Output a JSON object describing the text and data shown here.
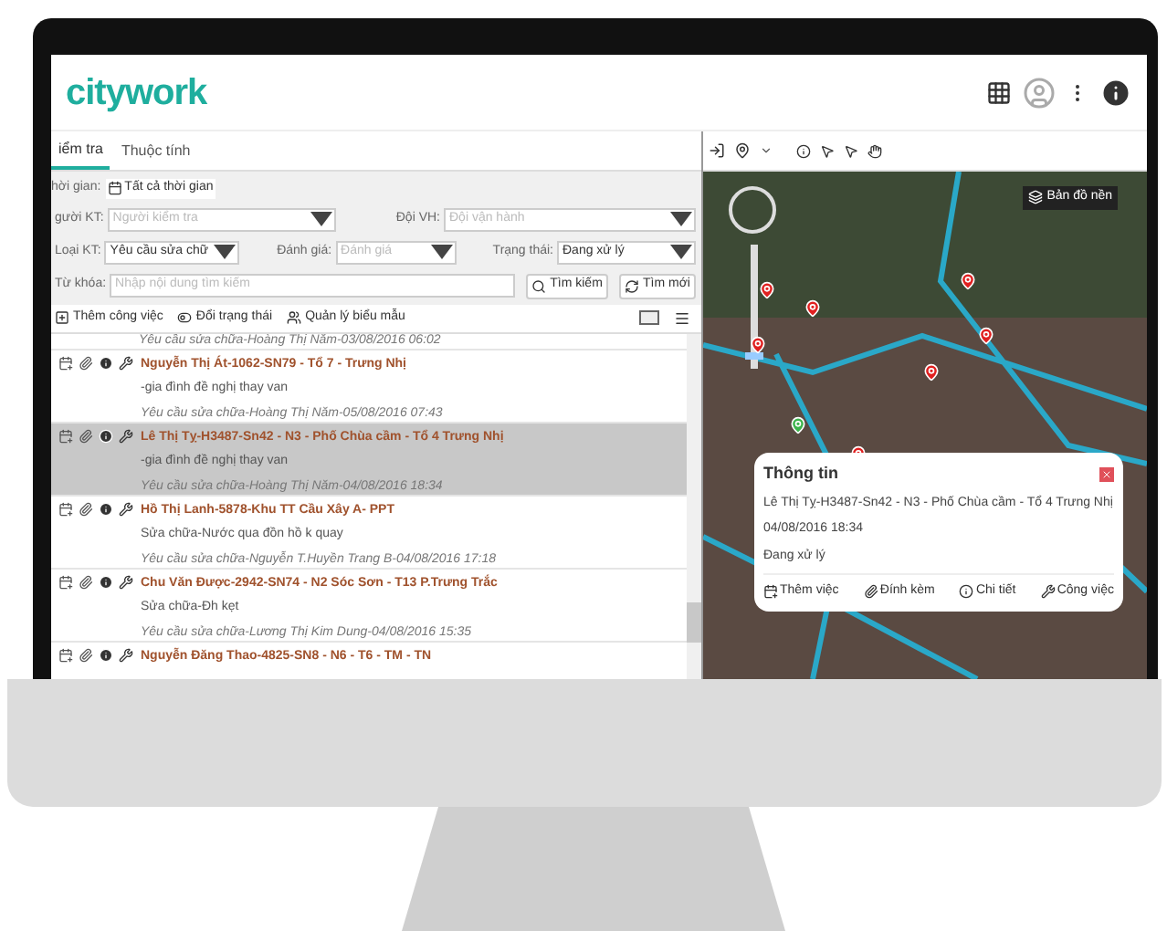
{
  "header": {
    "logo": "citywork"
  },
  "tabs": [
    {
      "label": "iểm tra",
      "selected": true
    },
    {
      "label": "Thuộc tính",
      "selected": false
    }
  ],
  "filters": {
    "time_label": "hời gian:",
    "time_value": "Tất cả thời gian",
    "rows": [
      {
        "fields": [
          {
            "label": "gười KT:",
            "placeholder": "Người kiểm tra",
            "kind": "select"
          },
          {
            "label": "Đội VH:",
            "placeholder": "Đội vận hành",
            "kind": "select"
          }
        ]
      },
      {
        "fields": [
          {
            "label": "Loại KT:",
            "value": "Yêu cầu sửa chữ",
            "kind": "select"
          },
          {
            "label": "Đánh giá:",
            "placeholder": "Đánh giá",
            "kind": "select"
          },
          {
            "label": "Trạng thái:",
            "value": "Đang xử lý",
            "kind": "select"
          }
        ]
      },
      {
        "fields": [
          {
            "label": "Từ khóa:",
            "placeholder": "Nhập nội dung tìm kiếm",
            "kind": "input"
          }
        ]
      }
    ],
    "buttons": [
      "Tìm kiếm",
      "Tìm mới"
    ]
  },
  "toolbar": [
    "Thêm công việc",
    "Đổi trạng thái",
    "Quản lý biểu mẫu"
  ],
  "list": {
    "partial_line": "Yêu cầu sửa chữa-Hoàng Thị Năm-03/08/2016 06:02",
    "items": [
      {
        "title": "Nguyễn Thị Át-1062-SN79 - Tổ 7 - Trưng Nhị",
        "description": "-gia đình đề nghị thay van",
        "meta": "Yêu cầu sửa chữa-Hoàng Thị Năm-05/08/2016 07:43",
        "selected": false
      },
      {
        "title": "Lê Thị Tỵ-H3487-Sn42 - N3 - Phố Chùa cầm - Tổ 4 Trưng Nhị",
        "description": "-gia đình đề nghị thay van",
        "meta": "Yêu cầu sửa chữa-Hoàng Thị Năm-04/08/2016 18:34",
        "selected": true
      },
      {
        "title": "Hồ Thị Lanh-5878-Khu TT Cầu Xây A- PPT",
        "description": "Sửa chữa-Nước qua đồn hồ k quay",
        "meta": "Yêu cầu sửa chữa-Nguyễn T.Huyền Trang B-04/08/2016 17:18",
        "selected": false
      },
      {
        "title": "Chu Văn Được-2942-SN74 - N2 Sóc Sơn - T13 P.Trưng Trắc",
        "description": "Sửa chữa-Đh kẹt",
        "meta": "Yêu cầu sửa chữa-Lương Thị Kim Dung-04/08/2016 15:35",
        "selected": false
      },
      {
        "title": "Nguyễn Đăng Thao-4825-SN8 - N6 - T6 - TM - TN",
        "selected": false
      }
    ]
  },
  "map": {
    "zoom": {
      "level": 0.1
    },
    "layer_button": "Bản đồ nền",
    "popup": {
      "title": "Thông tin",
      "address": "Lê Thị Tỵ-H3487-Sn42 - N3 - Phố Chùa cầm - Tổ 4 Trưng Nhị",
      "time": "04/08/2016 18:34",
      "status": "Đang xử lý",
      "actions": [
        "Thêm việc",
        "Đính kèm",
        "Chi tiết",
        "Công việc"
      ]
    }
  }
}
